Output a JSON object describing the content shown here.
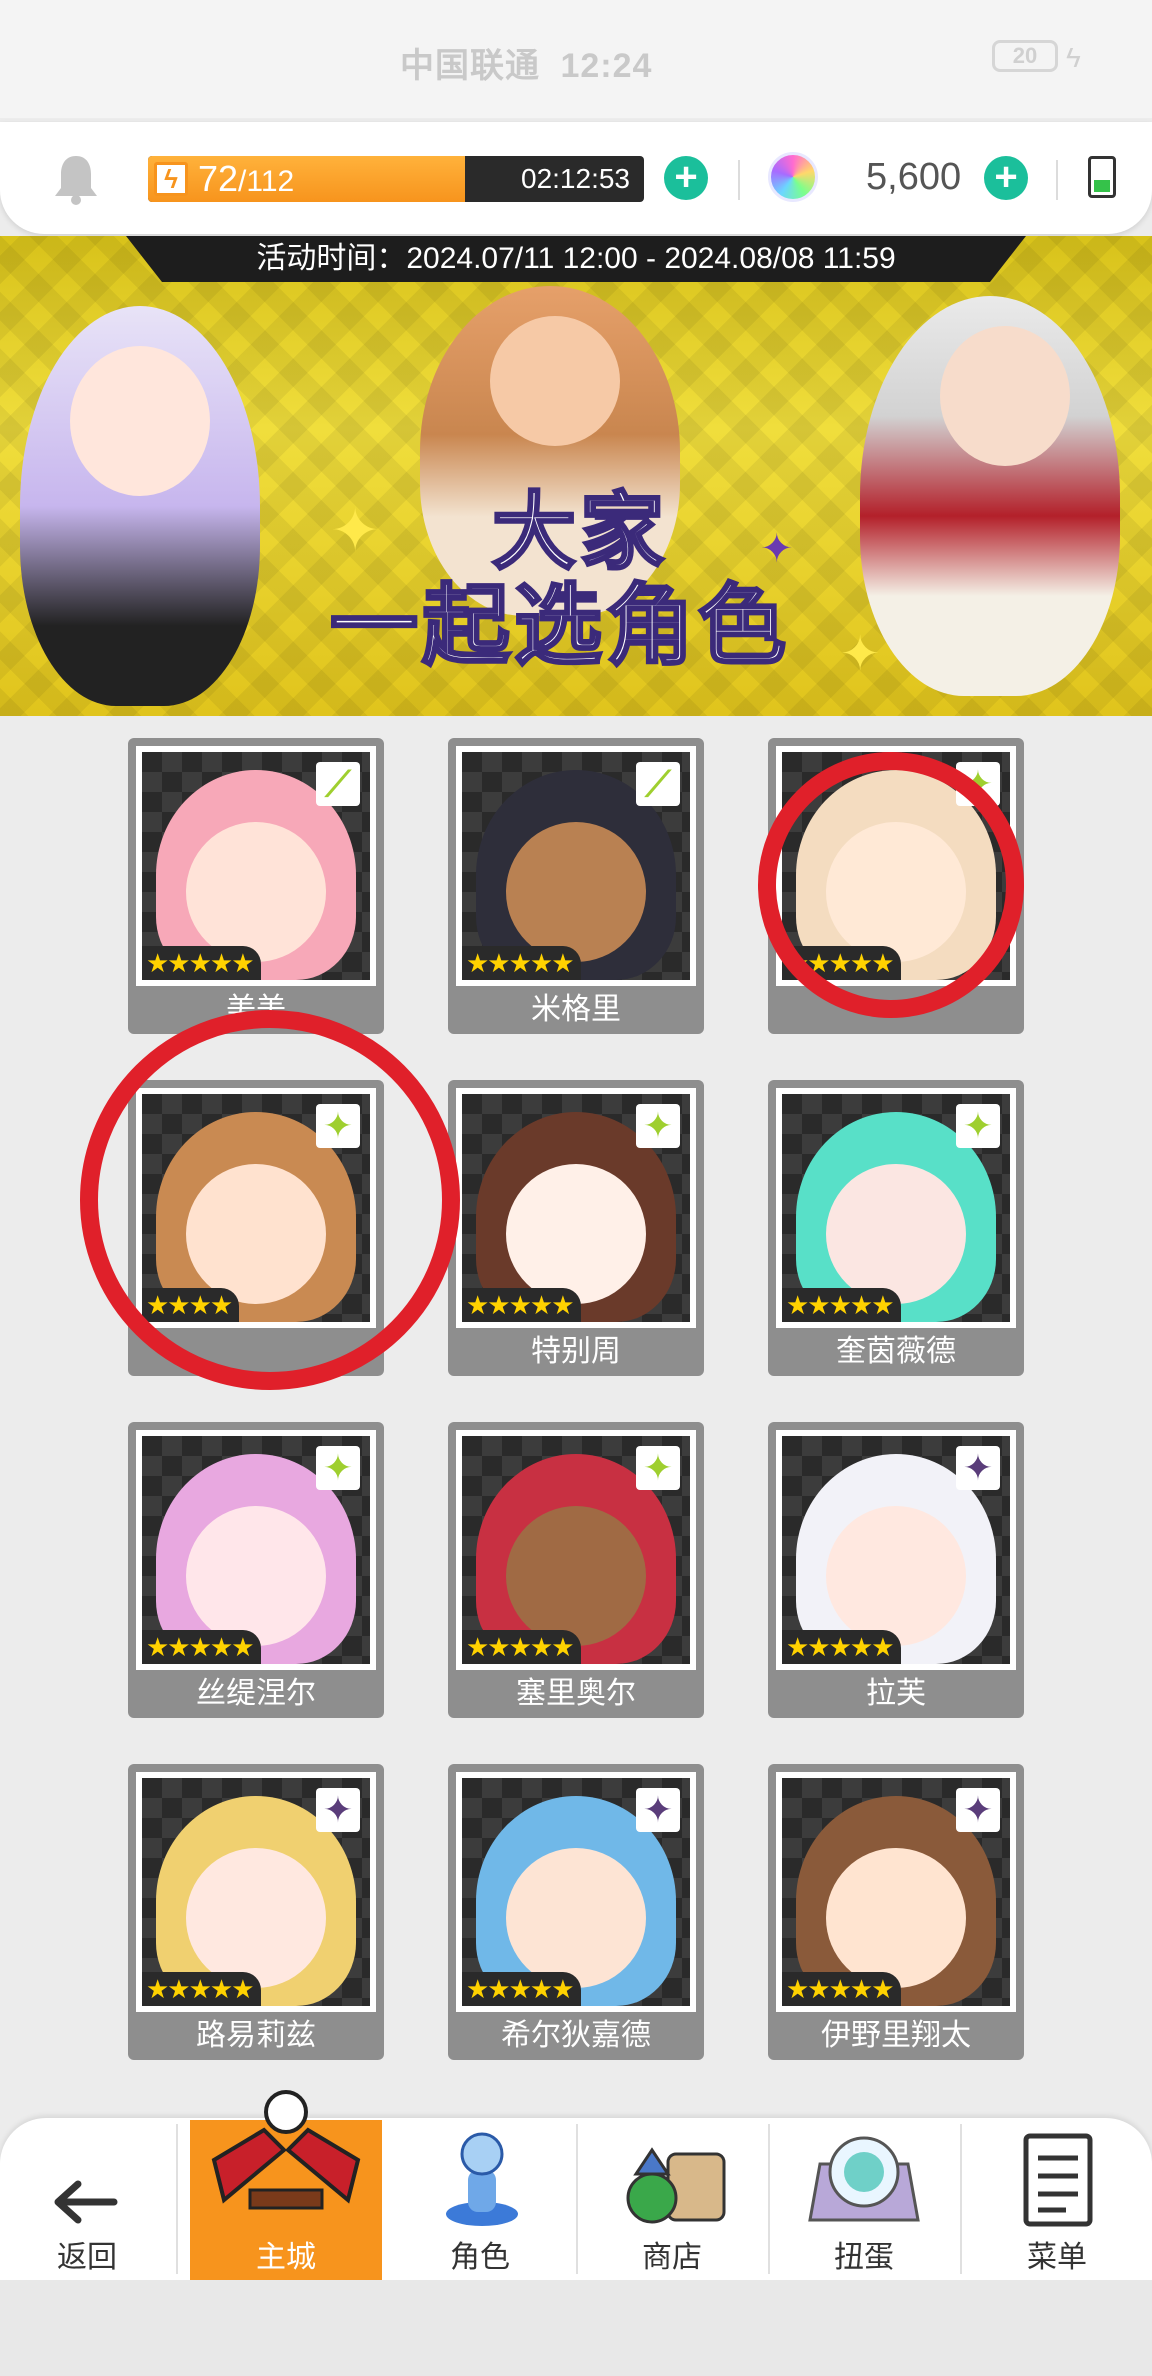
{
  "status_bar": {
    "carrier": "中国联通",
    "time": "12:24",
    "battery": "20"
  },
  "resources": {
    "stamina_current": "72",
    "stamina_max": "/112",
    "stamina_fraction": 0.64,
    "stamina_timer": "02:12:53",
    "gems": "5,600",
    "stamina_icon": "lightning-icon",
    "gem_icon": "rainbow-gem-icon",
    "bell_icon": "bell-icon"
  },
  "banner": {
    "event_time": "活动时间：2024.07/11 12:00 - 2024.08/08 11:59",
    "title_line1": "大家",
    "title_line2": "一起选角色"
  },
  "characters": [
    {
      "name": "美美",
      "stars": "★★★★★",
      "element": "leaf"
    },
    {
      "name": "米格里",
      "stars": "★★★★★",
      "element": "leaf"
    },
    {
      "name": "",
      "stars": "★★★★★",
      "element": "light"
    },
    {
      "name": "",
      "stars": "★★★★",
      "element": "light"
    },
    {
      "name": "特别周",
      "stars": "★★★★★",
      "element": "light"
    },
    {
      "name": "奎茵薇德",
      "stars": "★★★★★",
      "element": "light"
    },
    {
      "name": "丝缇涅尔",
      "stars": "★★★★★",
      "element": "light"
    },
    {
      "name": "塞里奥尔",
      "stars": "★★★★★",
      "element": "light"
    },
    {
      "name": "拉芙",
      "stars": "★★★★★",
      "element": "dark"
    },
    {
      "name": "路易莉兹",
      "stars": "★★★★★",
      "element": "dark"
    },
    {
      "name": "希尔狄嘉德",
      "stars": "★★★★★",
      "element": "dark"
    },
    {
      "name": "伊野里翔太",
      "stars": "★★★★★",
      "element": "dark"
    }
  ],
  "nav": {
    "back": "返回",
    "home": "主城",
    "characters": "角色",
    "shop": "商店",
    "gacha": "扭蛋",
    "menu": "菜单"
  },
  "colors": {
    "accent_orange": "#f7941d",
    "plus_teal": "#1bbf9b",
    "highlight_red": "#e0202a"
  }
}
